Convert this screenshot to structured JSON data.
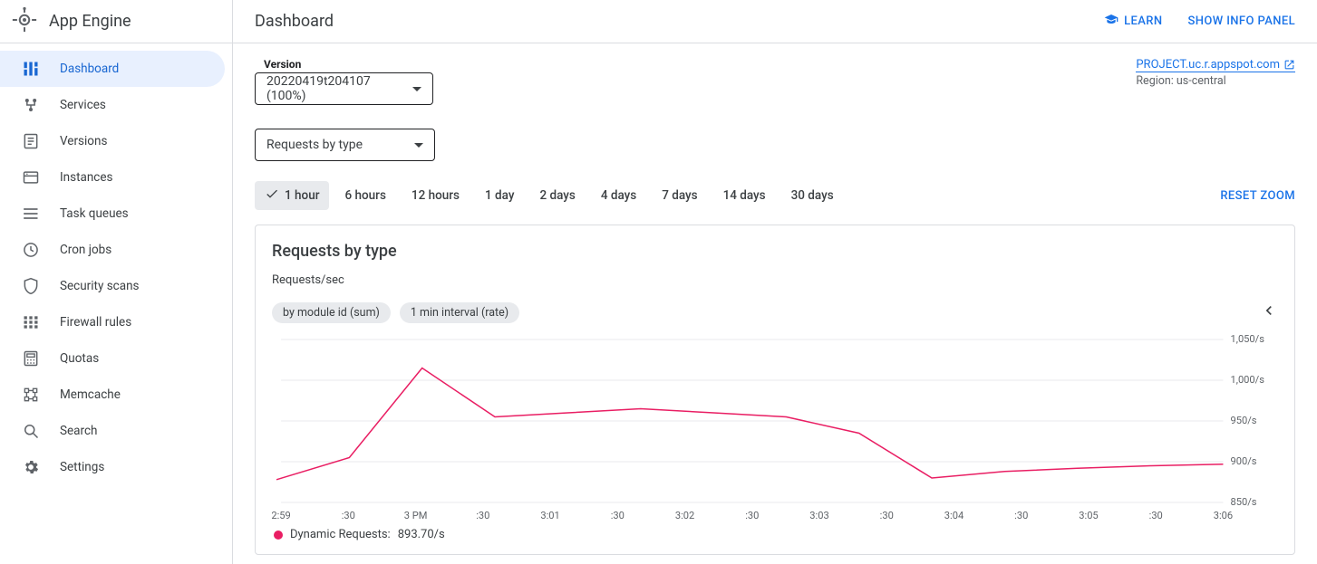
{
  "product_name": "App Engine",
  "sidebar": {
    "items": [
      {
        "label": "Dashboard",
        "active": true
      },
      {
        "label": "Services"
      },
      {
        "label": "Versions"
      },
      {
        "label": "Instances"
      },
      {
        "label": "Task queues"
      },
      {
        "label": "Cron jobs"
      },
      {
        "label": "Security scans"
      },
      {
        "label": "Firewall rules"
      },
      {
        "label": "Quotas"
      },
      {
        "label": "Memcache"
      },
      {
        "label": "Search"
      },
      {
        "label": "Settings"
      }
    ]
  },
  "topbar": {
    "title": "Dashboard",
    "learn": "LEARN",
    "info_panel": "SHOW INFO PANEL"
  },
  "version_field": {
    "label": "Version",
    "value": "20220419t204107 (100%)"
  },
  "project": {
    "link_text": "PROJECT.uc.r.appspot.com",
    "region_text": "Region: us-central"
  },
  "metric_selector": {
    "value": "Requests by type"
  },
  "time_ranges": [
    "1 hour",
    "6 hours",
    "12 hours",
    "1 day",
    "2 days",
    "4 days",
    "7 days",
    "14 days",
    "30 days"
  ],
  "selected_range_index": 0,
  "reset_zoom": "RESET ZOOM",
  "chart": {
    "title": "Requests by type",
    "y_unit_label": "Requests/sec",
    "chips": [
      "by module id (sum)",
      "1 min interval (rate)"
    ],
    "legend": {
      "series_name": "Dynamic Requests:",
      "value": "893.70/s"
    }
  },
  "chart_data": {
    "type": "line",
    "ylabel": "Requests/sec",
    "ylim": [
      850,
      1050
    ],
    "y_ticks": [
      "1,050/s",
      "1,000/s",
      "950/s",
      "900/s",
      "850/s"
    ],
    "x_ticks": [
      "2:59",
      ":30",
      "3 PM",
      ":30",
      "3:01",
      ":30",
      "3:02",
      ":30",
      "3:03",
      ":30",
      "3:04",
      ":30",
      "3:05",
      ":30",
      "3:06"
    ],
    "series": [
      {
        "name": "Dynamic Requests",
        "color": "#e91e63",
        "values": [
          878,
          905,
          1015,
          955,
          960,
          965,
          960,
          955,
          935,
          880,
          888,
          892,
          895,
          897
        ]
      }
    ]
  }
}
